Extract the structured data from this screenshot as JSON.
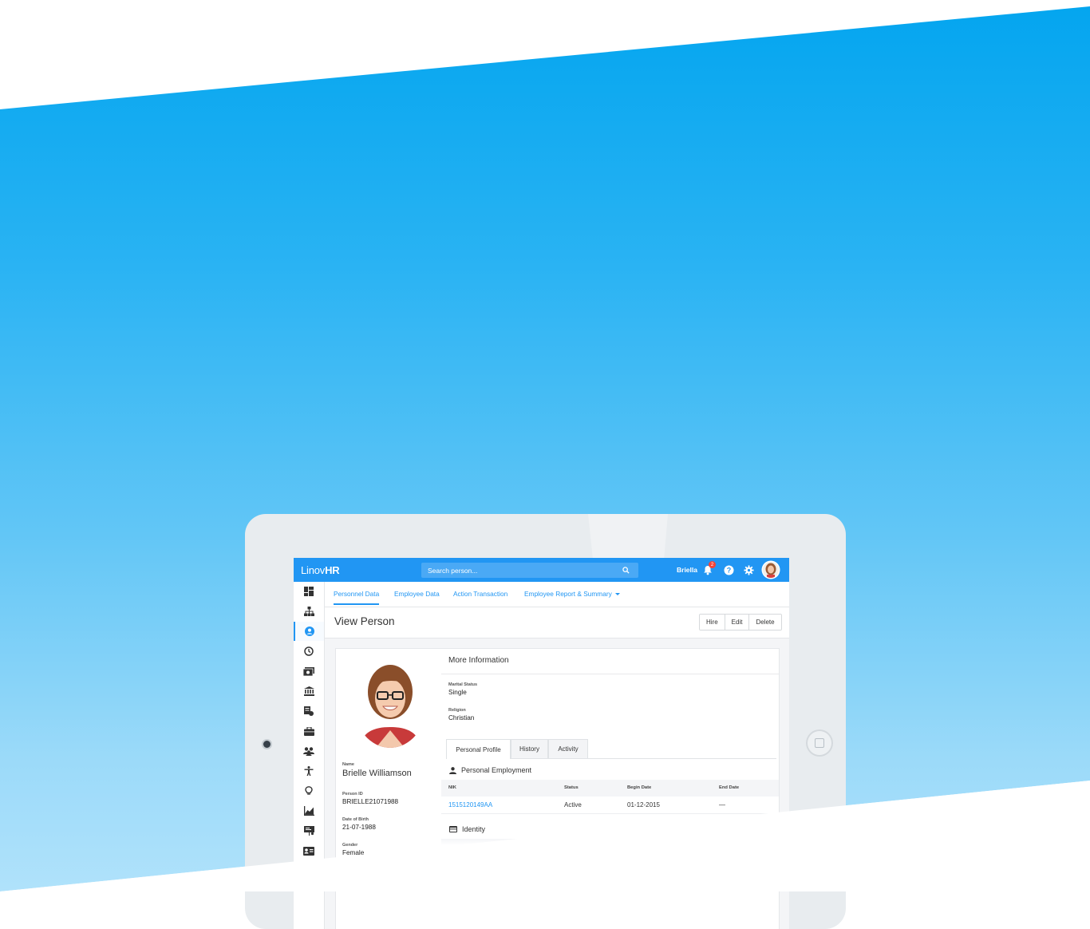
{
  "app": {
    "logo_light": "Linov",
    "logo_bold": "HR",
    "search_placeholder": "Search person...",
    "user_name": "Briella",
    "notification_count": "2"
  },
  "subnav": {
    "tabs": [
      "Personnel Data",
      "Employee Data",
      "Action Transaction",
      "Employee Report & Summary"
    ],
    "active": "Personnel Data"
  },
  "page": {
    "title": "View Person",
    "buttons": [
      "Hire",
      "Edit",
      "Delete"
    ]
  },
  "person": {
    "name_label": "Name",
    "name": "Brielle Williamson",
    "id_label": "Person ID",
    "id": "BRIELLE21071988",
    "dob_label": "Date of Birth",
    "dob": "21-07-1988",
    "gender_label": "Gender",
    "gender": "Female"
  },
  "more_info": {
    "title": "More Information",
    "marital_label": "Marital Status",
    "marital": "Single",
    "religion_label": "Religion",
    "religion": "Christian"
  },
  "profile_tabs": [
    "Personal Profile",
    "History",
    "Activity"
  ],
  "employment": {
    "title": "Personal Employment",
    "columns": [
      "NIK",
      "Status",
      "Begin Date",
      "End Date"
    ],
    "rows": [
      [
        "1515120149AA",
        "Active",
        "01-12-2015",
        "—"
      ]
    ]
  },
  "identity": {
    "title": "Identity"
  },
  "colors": {
    "brand": "#2196f3",
    "hero_top": "#03a5ef",
    "hero_bottom": "#b0e2fb",
    "badge": "#f44336"
  },
  "sidebar_icons": [
    "dashboard-icon",
    "org-chart-icon",
    "person-icon",
    "clock-icon",
    "payroll-icon",
    "bank-icon",
    "report-icon",
    "briefcase-icon",
    "group-icon",
    "accessibility-icon",
    "lightbulb-icon",
    "analytics-icon",
    "presentation-icon",
    "id-card-icon"
  ]
}
